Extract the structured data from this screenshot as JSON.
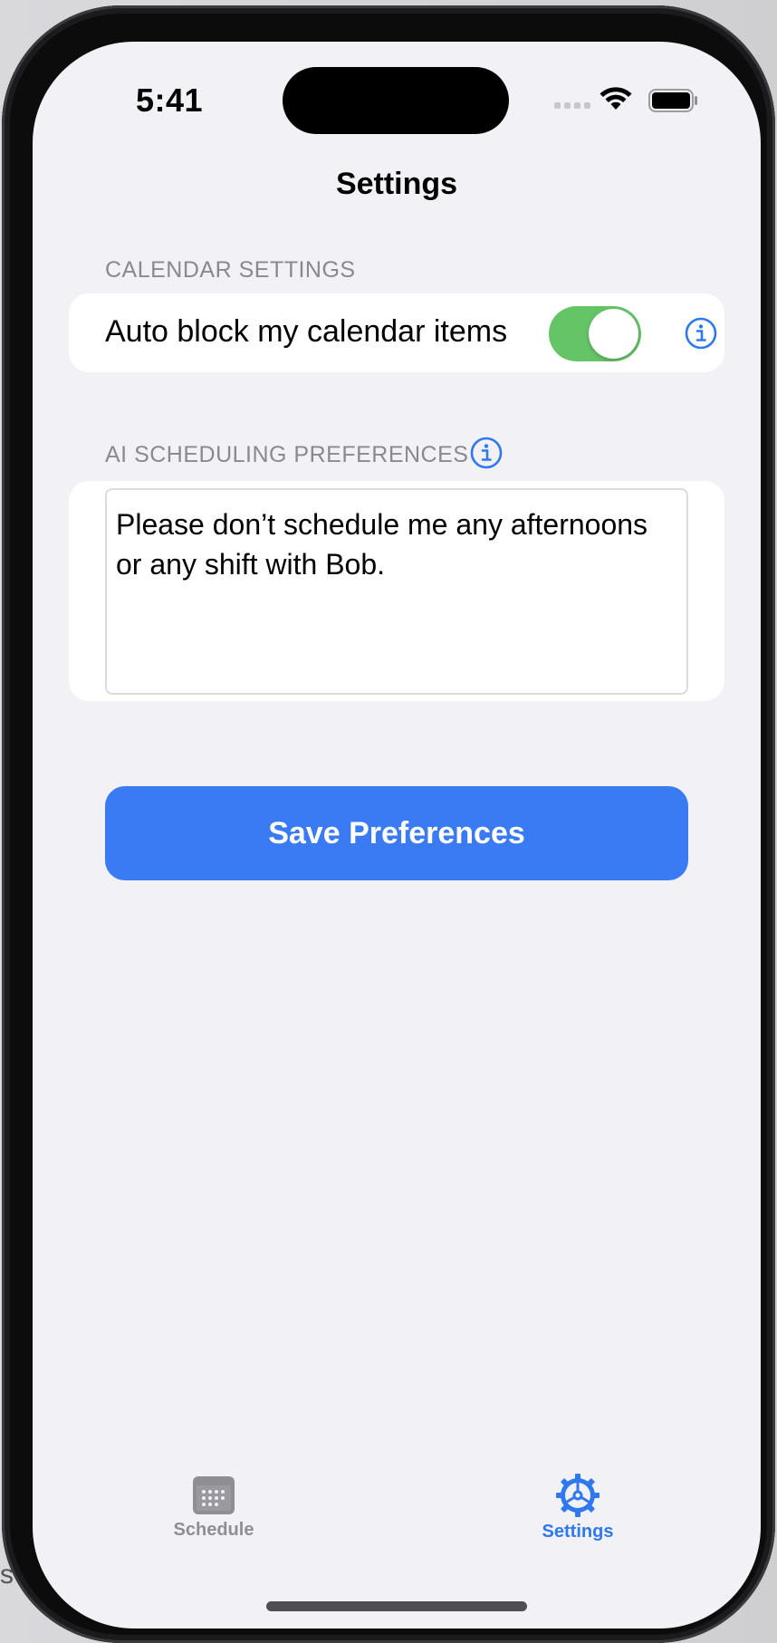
{
  "status_bar": {
    "time": "5:41"
  },
  "nav": {
    "title": "Settings"
  },
  "calendar_section": {
    "header": "CALENDAR SETTINGS",
    "auto_block_label": "Auto block my calendar items",
    "auto_block_enabled": true
  },
  "ai_section": {
    "header": "AI SCHEDULING PREFERENCES",
    "preferences_text": "Please don’t schedule me any afternoons or any shift with Bob."
  },
  "save_button": {
    "label": "Save Preferences"
  },
  "tab_bar": {
    "items": [
      {
        "label": "Schedule",
        "icon": "calendar-icon",
        "active": false
      },
      {
        "label": "Settings",
        "icon": "gear-icon",
        "active": true
      }
    ]
  },
  "colors": {
    "accent": "#3a7bf3",
    "toggle_on": "#65c466",
    "background": "#f1f1f6",
    "secondary_text": "#8a8a8e"
  }
}
